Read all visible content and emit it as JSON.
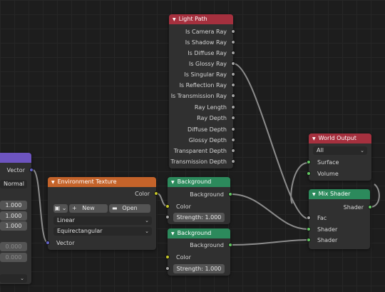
{
  "colors": {
    "background": "#1d1d1d",
    "header_light_path": "#a5303e",
    "header_world_output": "#a5303e",
    "header_background": "#2c8a5c",
    "header_environment": "#c4632a",
    "header_mix_shader": "#2c8a5c",
    "header_partial": "#6d54c0",
    "socket_gray": "#a3a3a3",
    "socket_yellow": "#c7c729",
    "socket_green": "#63c763",
    "socket_blue": "#6363c7",
    "wire": "#8c8c8c"
  },
  "light_path": {
    "title": "Light Path",
    "outputs": [
      "Is Camera Ray",
      "Is Shadow Ray",
      "Is Diffuse Ray",
      "Is Glossy Ray",
      "Is Singular Ray",
      "Is Reflection Ray",
      "Is Transmission Ray",
      "Ray Length",
      "Ray Depth",
      "Diffuse Depth",
      "Glossy Depth",
      "Transparent Depth",
      "Transmission Depth"
    ]
  },
  "world_output": {
    "title": "World Output",
    "target": "All",
    "inputs": [
      "Surface",
      "Volume"
    ]
  },
  "mix_shader": {
    "title": "Mix Shader",
    "output": "Shader",
    "inputs": [
      "Fac",
      "Shader",
      "Shader"
    ]
  },
  "background1": {
    "title": "Background",
    "output": "Background",
    "color_label": "Color",
    "strength_field": "Strength: 1.000"
  },
  "background2": {
    "title": "Background",
    "output": "Background",
    "color_label": "Color",
    "strength_field": "Strength: 1.000"
  },
  "environment_texture": {
    "title": "Environment Texture",
    "output": "Color",
    "new_label": "New",
    "open_label": "Open",
    "interpolation": "Linear",
    "projection": "Equirectangular",
    "input": "Vector"
  },
  "partial_node": {
    "output": "Vector",
    "dropdown": "Normal",
    "values": [
      "1.000",
      "1.000",
      "1.000",
      "0.000",
      "0.000"
    ]
  }
}
